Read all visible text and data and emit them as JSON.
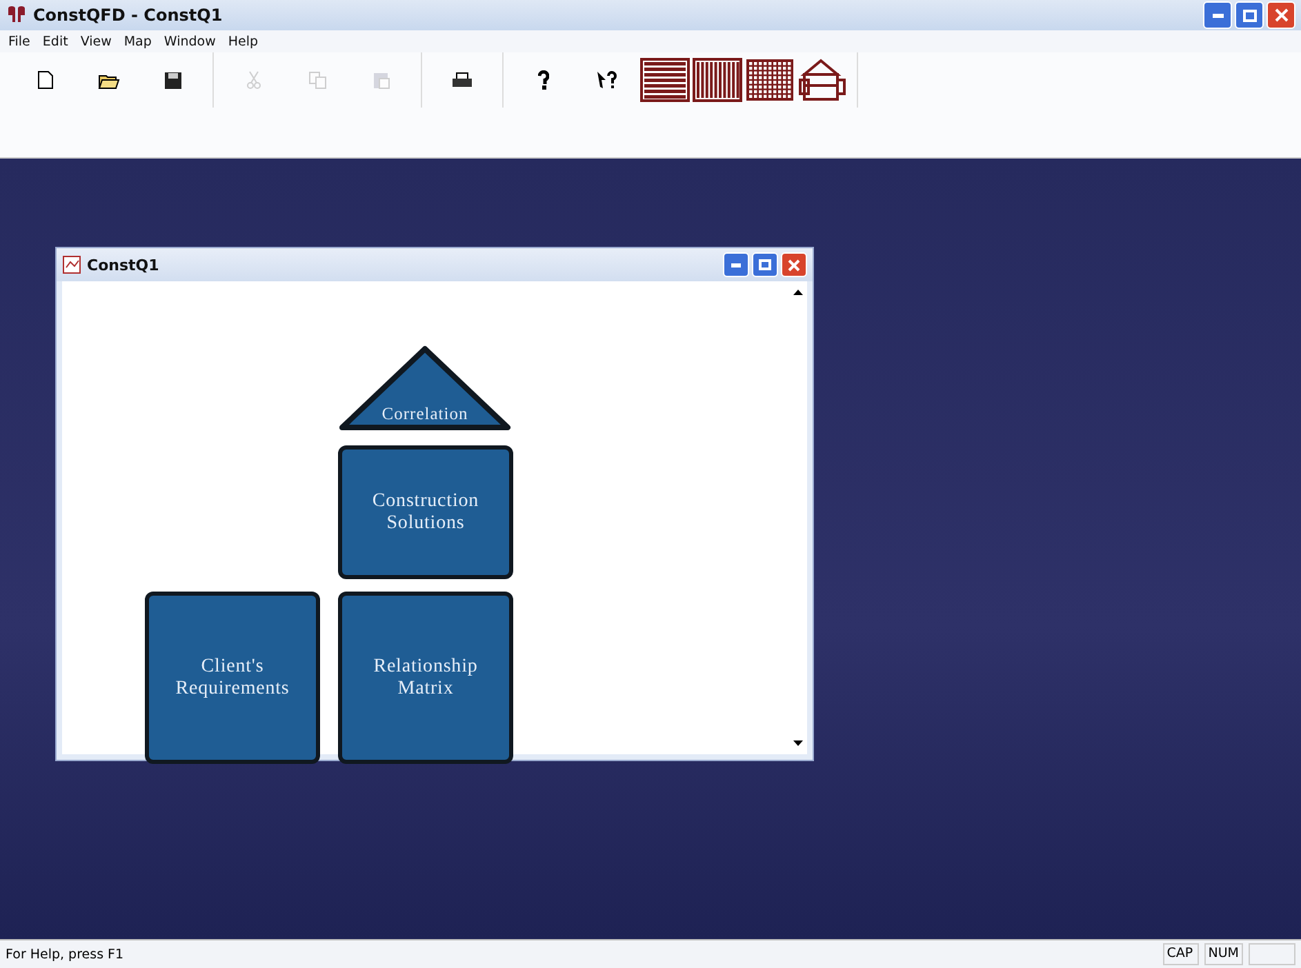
{
  "window": {
    "title": "ConstQFD - ConstQ1"
  },
  "menu": [
    "File",
    "Edit",
    "View",
    "Map",
    "Window",
    "Help"
  ],
  "toolbar": [
    {
      "kind": "new",
      "disabled": false
    },
    {
      "kind": "open",
      "disabled": false
    },
    {
      "kind": "save",
      "disabled": false
    },
    {
      "kind": "cut",
      "disabled": true
    },
    {
      "kind": "copy",
      "disabled": true
    },
    {
      "kind": "paste",
      "disabled": true
    },
    {
      "kind": "print",
      "disabled": false
    },
    {
      "kind": "help",
      "disabled": false
    },
    {
      "kind": "context-help",
      "disabled": false
    },
    {
      "kind": "rows-view",
      "disabled": false
    },
    {
      "kind": "columns-view",
      "disabled": false
    },
    {
      "kind": "matrix-view",
      "disabled": false
    },
    {
      "kind": "house-view",
      "disabled": false
    }
  ],
  "child_window": {
    "title": "ConstQ1",
    "diagram": [
      {
        "kind": "triangle",
        "label": "Correlation"
      },
      {
        "kind": "box",
        "label": "Construction Solutions"
      },
      {
        "kind": "box",
        "label": "Client's Requirements"
      },
      {
        "kind": "box",
        "label": "Relationship Matrix"
      }
    ]
  },
  "status_bar": {
    "text": "For Help, press F1",
    "indicators": [
      "CAP",
      "NUM"
    ]
  }
}
